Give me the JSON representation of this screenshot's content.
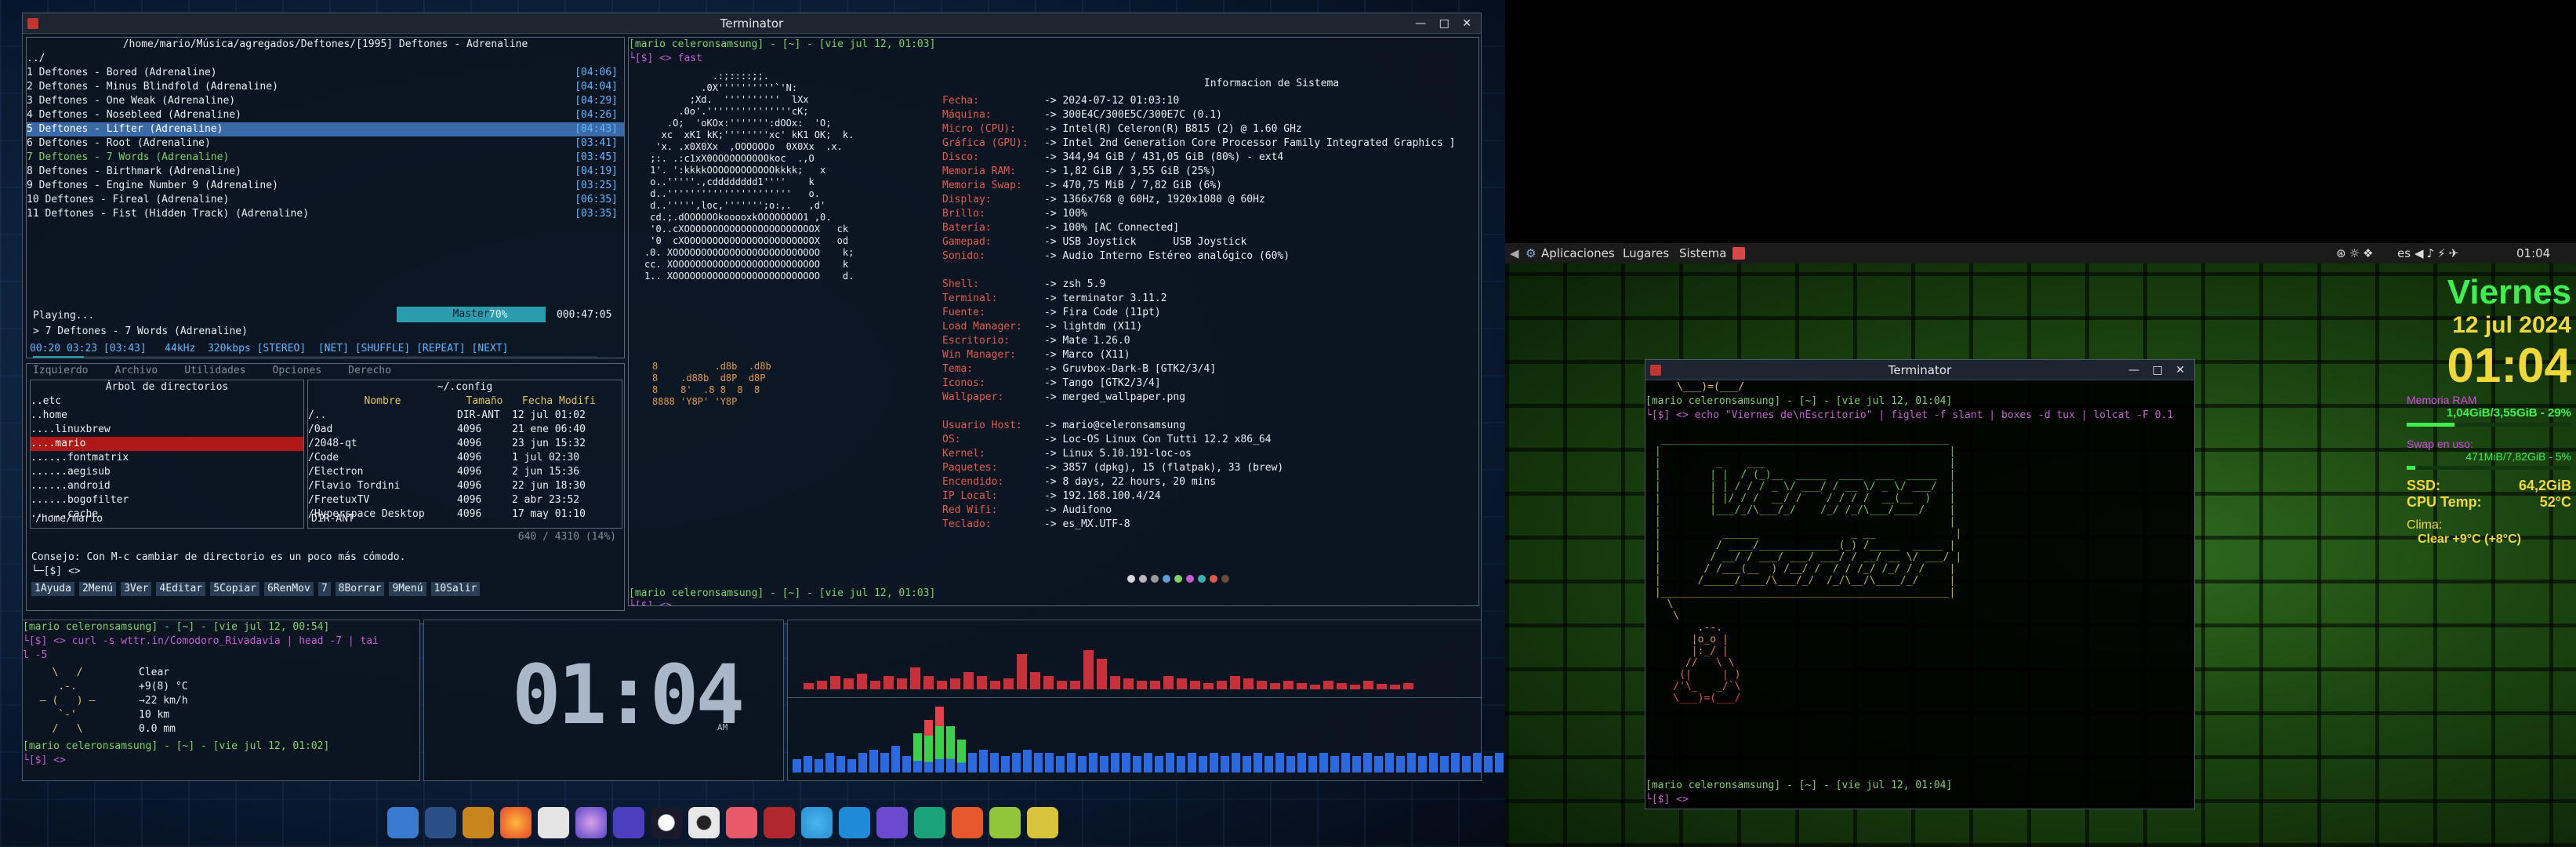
{
  "music": {
    "path": "/home/mario/Música/agregados/Deftones/[1995] Deftones - Adrenaline",
    "up": "../",
    "tracks": [
      {
        "t": "1 Deftones - Bored (Adrenaline)",
        "d": "[04:06]"
      },
      {
        "t": "2 Deftones - Minus Blindfold (Adrenaline)",
        "d": "[04:04]"
      },
      {
        "t": "3 Deftones - One Weak (Adrenaline)",
        "d": "[04:29]"
      },
      {
        "t": "4 Deftones - Nosebleed (Adrenaline)",
        "d": "[04:26]"
      },
      {
        "t": "5 Deftones - Lifter (Adrenaline)",
        "d": "[04:43]"
      },
      {
        "t": "6 Deftones - Root (Adrenaline)",
        "d": "[03:41]"
      },
      {
        "t": "7 Deftones - 7 Words (Adrenaline)",
        "d": "[03:45]"
      },
      {
        "t": "8 Deftones - Birthmark (Adrenaline)",
        "d": "[04:19]"
      },
      {
        "t": "9 Deftones - Engine Number 9 (Adrenaline)",
        "d": "[03:25]"
      },
      {
        "t": "10 Deftones - Fireal (Adrenaline)",
        "d": "[06:35]"
      },
      {
        "t": "11 Deftones - Fist (Hidden Track) (Adrenaline)",
        "d": "[03:35]"
      }
    ],
    "playing": "Playing...",
    "now": "> 7 Deftones - 7 Words (Adrenaline)",
    "master": "Master",
    "vol": "70%",
    "total": "000:47:05",
    "status": "00:20 03:23 [03:43]   44kHz  320kbps [STEREO]  [NET] [SHUFFLE] [REPEAT] [NEXT]",
    "progress": 0.09
  },
  "mc": {
    "tabs": [
      "Izquierdo",
      "Archivo",
      "Utilidades",
      "Opciones",
      "Derecho"
    ],
    "tree_title": "Árbol de directorios",
    "tree": [
      "..etc",
      "..home",
      "....linuxbrew",
      "....mario",
      "......fontmatrix",
      "......aegisub",
      "......android",
      "......bogofilter",
      "......cache"
    ],
    "tree_path": "/home/mario",
    "right_title": "~/.config",
    "cols": [
      "Nombre",
      "Tamaño",
      "Fecha Modifi"
    ],
    "files": [
      [
        "/..",
        "DIR-ANT",
        "12 jul 01:02"
      ],
      [
        "/0ad",
        "4096",
        "21 ene 06:40"
      ],
      [
        "/2048-qt",
        "4096",
        "23 jun 15:32"
      ],
      [
        "/Code",
        "4096",
        "1 jul 02:30"
      ],
      [
        "/Electron",
        "4096",
        "2 jun 15:36"
      ],
      [
        "/Flavio Tordini",
        "4096",
        "22 jun 18:30"
      ],
      [
        "/FreetuxTV",
        "4096",
        "2 abr 23:52"
      ],
      [
        "/Hyperspace Desktop",
        "4096",
        "17 may 01:10"
      ]
    ],
    "right_foot": "DIR-ANT",
    "usage": "640 / 4310 (14%)",
    "hint": "Consejo: Con M-c cambiar de directorio es un poco más cómodo.",
    "prompt": "└─[$] <> ",
    "fkeys": [
      "1Ayuda",
      "2Menú",
      "3Ver",
      "4Editar",
      "5Copiar",
      "6RenMov",
      "7",
      "8Borrar",
      "9Menú",
      "10Salir"
    ]
  },
  "terminator": {
    "title": "Terminator",
    "prompt1": "[mario celeronsamsung] - [~] - [vie jul 12, 01:03]",
    "cmd": "└[$] <> fast",
    "prompt2": "[mario celeronsamsung] - [~] - [vie jul 12, 01:03]",
    "prompt2b": "└[$] <> "
  },
  "sysinfo": {
    "title": "Informacion de Sistema",
    "rows": [
      [
        "Fecha:",
        "2024-07-12 01:03:10"
      ],
      [
        "Máquina:",
        "300E4C/300E5C/300E7C (0.1)"
      ],
      [
        "Micro (CPU):",
        "Intel(R) Celeron(R) B815 (2) @ 1.60 GHz"
      ],
      [
        "Gráfica (GPU):",
        "Intel 2nd Generation Core Processor Family Integrated Graphics ]"
      ],
      [
        "Disco:",
        "344,94 GiB / 431,05 GiB (80%) - ext4"
      ],
      [
        "Memoria RAM:",
        "1,82 GiB / 3,55 GiB (25%)"
      ],
      [
        "Memoria Swap:",
        "470,75 MiB / 7,82 GiB (6%)"
      ],
      [
        "Display:",
        "1366x768 @ 60Hz, 1920x1080 @ 60Hz"
      ],
      [
        "Brillo:",
        "100%"
      ],
      [
        "Batería:",
        "100% [AC Connected]"
      ],
      [
        "Gamepad:",
        "USB Joystick      USB Joystick"
      ],
      [
        "Sonido:",
        "Audio Interno Estéreo analógico (60%)"
      ],
      [
        "Shell:",
        "zsh 5.9"
      ],
      [
        "Terminal:",
        "terminator 3.11.2"
      ],
      [
        "Fuente:",
        "Fira Code (11pt)"
      ],
      [
        "Load Manager:",
        "lightdm (X11)"
      ],
      [
        "Escritorio:",
        "Mate 1.26.0"
      ],
      [
        "Win Manager:",
        "Marco (X11)"
      ],
      [
        "Tema:",
        "Gruvbox-Dark-B [GTK2/3/4]"
      ],
      [
        "Iconos:",
        "Tango [GTK2/3/4]"
      ],
      [
        "Wallpaper:",
        "merged_wallpaper.png"
      ],
      [
        "Usuario Host:",
        "mario@celeronsamsung"
      ],
      [
        "OS:",
        "Loc-OS Linux Con Tutti 12.2 x86_64"
      ],
      [
        "Kernel:",
        "Linux 5.10.191-loc-os"
      ],
      [
        "Paquetes:",
        "3857 (dpkg), 15 (flatpak), 33 (brew)"
      ],
      [
        "Encendido:",
        "8 days, 22 hours, 20 mins"
      ],
      [
        "IP Local:",
        "192.168.100.4/24"
      ],
      [
        "Red Wifi:",
        "Audifono"
      ],
      [
        "Teclado:",
        "es_MX.UTF-8"
      ]
    ]
  },
  "weather": {
    "prompt": "[mario celeronsamsung] - [~] - [vie jul 12, 00:54]",
    "cmd": "└[$] <> curl -s wttr.in/Comodoro_Rivadavia | head -7 | tai",
    "cmd2": "l -5",
    "lines": [
      "Clear",
      "+9(8) °C",
      "→22 km/h",
      "10 km",
      "0.0 mm"
    ],
    "prompt2": "[mario celeronsamsung] - [~] - [vie jul 12, 01:02]",
    "prompt2b": "└[$] <> "
  },
  "clock": {
    "time": "01:04",
    "ampm": "AM"
  },
  "viz": {
    "top": [
      0.15,
      0.2,
      0.3,
      0.25,
      0.35,
      0.2,
      0.3,
      0.25,
      0.5,
      0.3,
      0.2,
      0.25,
      0.4,
      0.3,
      0.2,
      0.25,
      0.8,
      0.4,
      0.3,
      0.2,
      0.2,
      0.9,
      0.7,
      0.3,
      0.25,
      0.2,
      0.2,
      0.3,
      0.25,
      0.2,
      0.15,
      0.2,
      0.3,
      0.25,
      0.2,
      0.15,
      0.2,
      0.15,
      0.1,
      0.2,
      0.15,
      0.1,
      0.2,
      0.12,
      0.1,
      0.15
    ],
    "bottom": [
      0.2,
      0.25,
      0.2,
      0.3,
      0.25,
      0.2,
      0.3,
      0.35,
      0.3,
      0.4,
      0.25,
      0.6,
      0.8,
      1.0,
      0.7,
      0.5,
      0.3,
      0.35,
      0.3,
      0.25,
      0.3,
      0.35,
      0.3,
      0.3,
      0.25,
      0.3,
      0.25,
      0.3,
      0.25,
      0.3,
      0.3,
      0.25,
      0.3,
      0.25,
      0.3,
      0.25,
      0.3,
      0.25,
      0.3,
      0.25,
      0.3,
      0.25,
      0.3,
      0.25,
      0.3,
      0.25,
      0.3,
      0.25,
      0.3,
      0.25,
      0.3,
      0.25,
      0.3,
      0.25,
      0.3,
      0.25,
      0.3,
      0.25,
      0.3,
      0.25,
      0.3,
      0.25,
      0.3,
      0.25,
      0.3,
      0.25,
      0.3,
      0.25,
      0.3,
      0.25,
      0.3,
      0.25,
      0.3,
      0.25,
      0.3,
      0.25,
      0.3,
      0.25,
      0.3,
      0.25,
      0.3,
      0.25
    ]
  },
  "mate_panel": {
    "apps": "Aplicaciones",
    "places": "Lugares",
    "system": "Sistema",
    "lang": "es",
    "time": "01:04"
  },
  "term2": {
    "title": "Terminator",
    "prompt": "[mario celeronsamsung] - [~] - [vie jul 12, 01:04]",
    "cmd": "└[$] <> echo \"Viernes de\\nEscritorio\" | figlet -f slant | boxes -d tux | lolcat -F 0.1",
    "prompt2": "[mario celeronsamsung] - [~] - [vie jul 12, 01:04]",
    "prompt2b": "└[$] <> "
  },
  "conky": {
    "day": "Viernes",
    "date": "12 jul 2024",
    "time": "01:04",
    "ram_label": "Memoria RAM",
    "ram": "1,04GiB/3,55GiB - 29%",
    "ram_pct": 0.29,
    "swap_label": "Swap en uso:",
    "swap": "471MiB/7,82GiB - 5%",
    "swap_pct": 0.05,
    "ssd_label": "SSD:",
    "ssd": "64,2GiB",
    "cpu_label": "CPU Temp:",
    "cpu": "52°C",
    "clima_label": "Clima:",
    "clima": "Clear +9°C (+8°C)"
  }
}
